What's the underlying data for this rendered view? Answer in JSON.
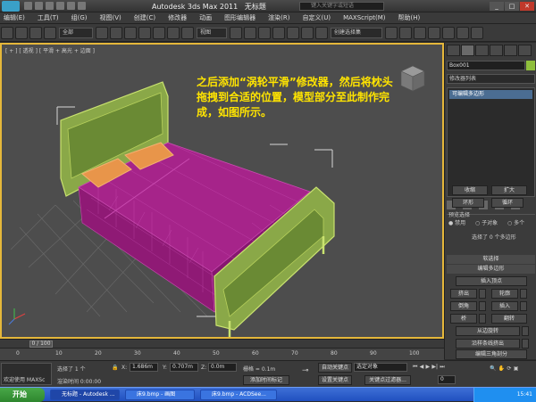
{
  "titlebar": {
    "app": "Autodesk 3ds Max  2011",
    "doc": "无标题",
    "search_placeholder": "键入关键字或短语"
  },
  "menubar": [
    "编辑(E)",
    "工具(T)",
    "组(G)",
    "视图(V)",
    "创建(C)",
    "修改器",
    "动画",
    "图形编辑器",
    "渲染(R)",
    "自定义(U)",
    "MAXScript(M)",
    "帮助(H)"
  ],
  "toolbar": {
    "select_filter": "全部",
    "ref_coord": "视图",
    "named_sel": "创建选择集"
  },
  "viewport": {
    "label": "[ + ] [ 透视 ] [ 平滑 + 高光 + 边面 ]",
    "annotation": "之后添加“涡轮平滑”修改器，然后将枕头拖拽到合适的位置，模型部分至此制作完成，如图所示。"
  },
  "command_panel": {
    "object_name": "Box001",
    "modifier_list": "修改器列表",
    "stack_entry": "可编辑多边形",
    "buttons": {
      "shrink": "收缩",
      "grow": "扩大",
      "ring": "环形",
      "loop": "循环",
      "insert_vertex": "插入顶点",
      "extrude": "挤出",
      "outline": "轮廓",
      "bevel": "倒角",
      "inset": "插入",
      "flip": "翻转",
      "hinge": "从边旋转",
      "extrude_spline": "沿样条线挤出",
      "edit_tri": "编辑三角剖分"
    },
    "preview_label": "预览选择",
    "preview_disabled": "禁用",
    "preview_sub": "子对象",
    "preview_multi": "多个",
    "selection_info": "选择了 0 个多边形",
    "soft_selection": "软选择",
    "edit_poly": "编辑多边形"
  },
  "timeline": {
    "frame": "0 / 100",
    "ticks": [
      "0",
      "10",
      "20",
      "30",
      "40",
      "50",
      "60",
      "70",
      "80",
      "90",
      "100"
    ]
  },
  "status": {
    "welcome": "欢迎使用 MAXSc",
    "selected": "选择了 1 个",
    "x_label": "X:",
    "x": "1.686m",
    "y_label": "Y:",
    "y": "0.707m",
    "z_label": "Z:",
    "z": "0.0m",
    "grid": "栅格 = 0.1m",
    "autokey": "自动关键点",
    "selobj": "选定对象",
    "setkey": "设置关键点",
    "keyfilter": "关键点过滤器...",
    "render_time": "渲染时间 0:00:00",
    "add_time_tag": "添加时间标记",
    "frame_num": "0"
  },
  "taskbar": {
    "start": "开始",
    "tasks": [
      "无标题 - Autodesk ...",
      "床9.bmp - 画图",
      "床9.bmp - ACDSee..."
    ],
    "clock": "15:41"
  }
}
